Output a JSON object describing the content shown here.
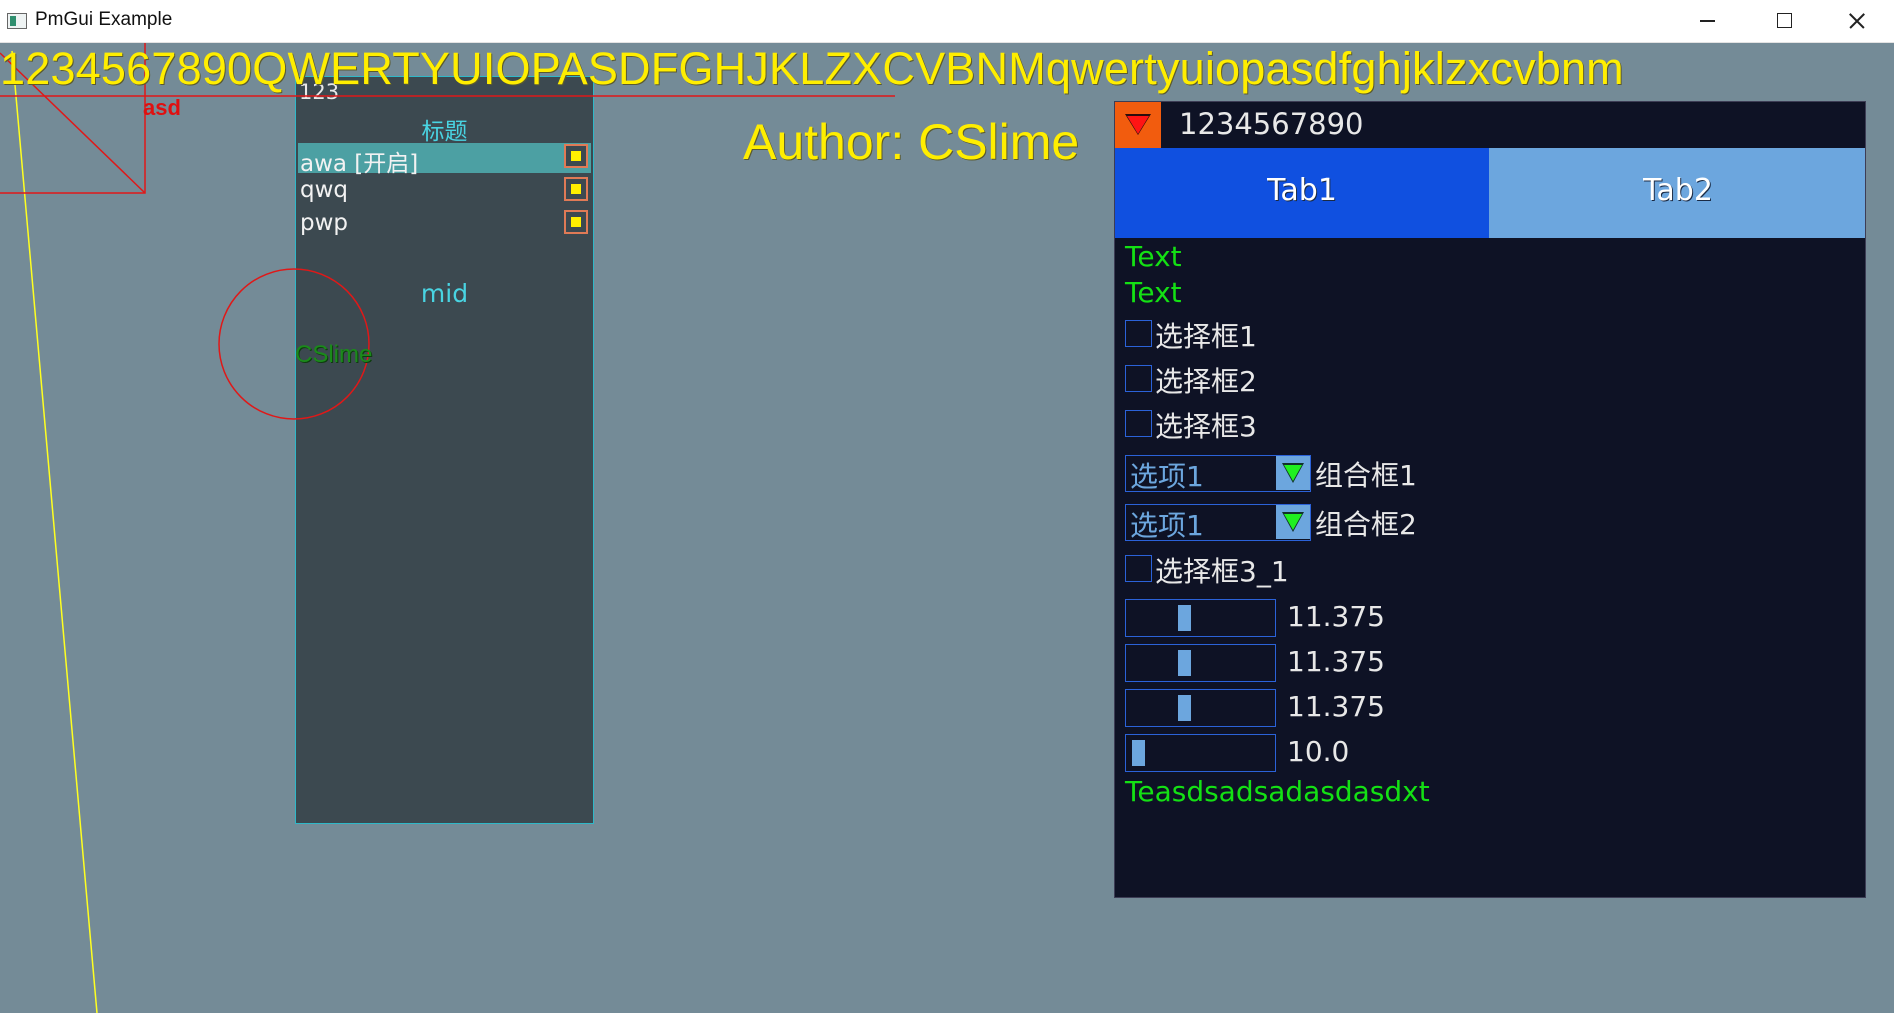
{
  "window": {
    "title": "PmGui Example"
  },
  "canvas": {
    "banner_text": "1234567890QWERTYUIOPASDFGHJKLZXCVBNMqwertyuiopasdfghjklzxcvbnm",
    "author_text": "Author: CSlime",
    "label_asd": "asd",
    "label_cslime": "CSlime"
  },
  "list_panel": {
    "head": "123",
    "title": "标题",
    "rows": [
      {
        "label": "awa [开启]",
        "active": true
      },
      {
        "label": "qwq",
        "active": false
      },
      {
        "label": "pwp",
        "active": false
      }
    ],
    "footer": "mid"
  },
  "tab_panel": {
    "title": "1234567890",
    "tabs": [
      {
        "label": "Tab1",
        "selected": true
      },
      {
        "label": "Tab2",
        "selected": false
      }
    ],
    "texts": [
      "Text",
      "Text"
    ],
    "checkboxes": [
      {
        "label": "选择框1",
        "checked": false
      },
      {
        "label": "选择框2",
        "checked": false
      },
      {
        "label": "选择框3",
        "checked": false
      }
    ],
    "combos": [
      {
        "value": "选项1",
        "label": "组合框1"
      },
      {
        "value": "选项1",
        "label": "组合框2"
      }
    ],
    "checkbox_extra": {
      "label": "选择框3_1",
      "checked": false
    },
    "sliders": [
      {
        "value": "11.375",
        "fraction": 0.37
      },
      {
        "value": "11.375",
        "fraction": 0.37
      },
      {
        "value": "11.375",
        "fraction": 0.37
      },
      {
        "value": "10.0",
        "fraction": 0.0
      }
    ],
    "bottom_text": "Teasdsadsadasdasdxt"
  },
  "colors": {
    "background": "#748b97",
    "accent_yellow": "#ffee00",
    "tab_selected": "#1050e0",
    "tab_unselected": "#6ca6de",
    "text_green": "#14e014",
    "panel_dark": "#0e1225"
  },
  "icons": [
    "app-icon",
    "minimize-icon",
    "maximize-icon",
    "close-icon",
    "collapse-triangle-icon",
    "dropdown-arrow-icon"
  ]
}
